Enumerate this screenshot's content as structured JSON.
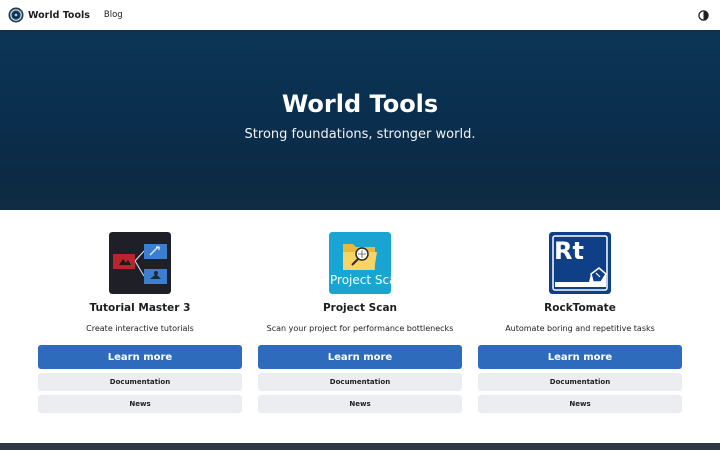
{
  "navbar": {
    "brand": "World Tools",
    "links": [
      "Blog"
    ],
    "theme_toggle_icon": "contrast-icon"
  },
  "hero": {
    "title": "World Tools",
    "tagline": "Strong foundations, stronger world."
  },
  "features": [
    {
      "title": "Tutorial Master 3",
      "description": "Create interactive tutorials",
      "icon": "tutorial-master-icon",
      "primary_label": "Learn more",
      "docs_label": "Documentation",
      "news_label": "News"
    },
    {
      "title": "Project Scan",
      "description": "Scan your project for performance bottlenecks",
      "icon": "project-scan-icon",
      "icon_text": "Project Sca",
      "primary_label": "Learn more",
      "docs_label": "Documentation",
      "news_label": "News"
    },
    {
      "title": "RockTomate",
      "description": "Automate boring and repetitive tasks",
      "icon": "rocktomate-icon",
      "icon_text": "Rt",
      "primary_label": "Learn more",
      "docs_label": "Documentation",
      "news_label": "News"
    }
  ],
  "colors": {
    "primary": "#2f6bbd",
    "hero_bg": "#0a2f4f",
    "footer_bg": "#303846"
  }
}
